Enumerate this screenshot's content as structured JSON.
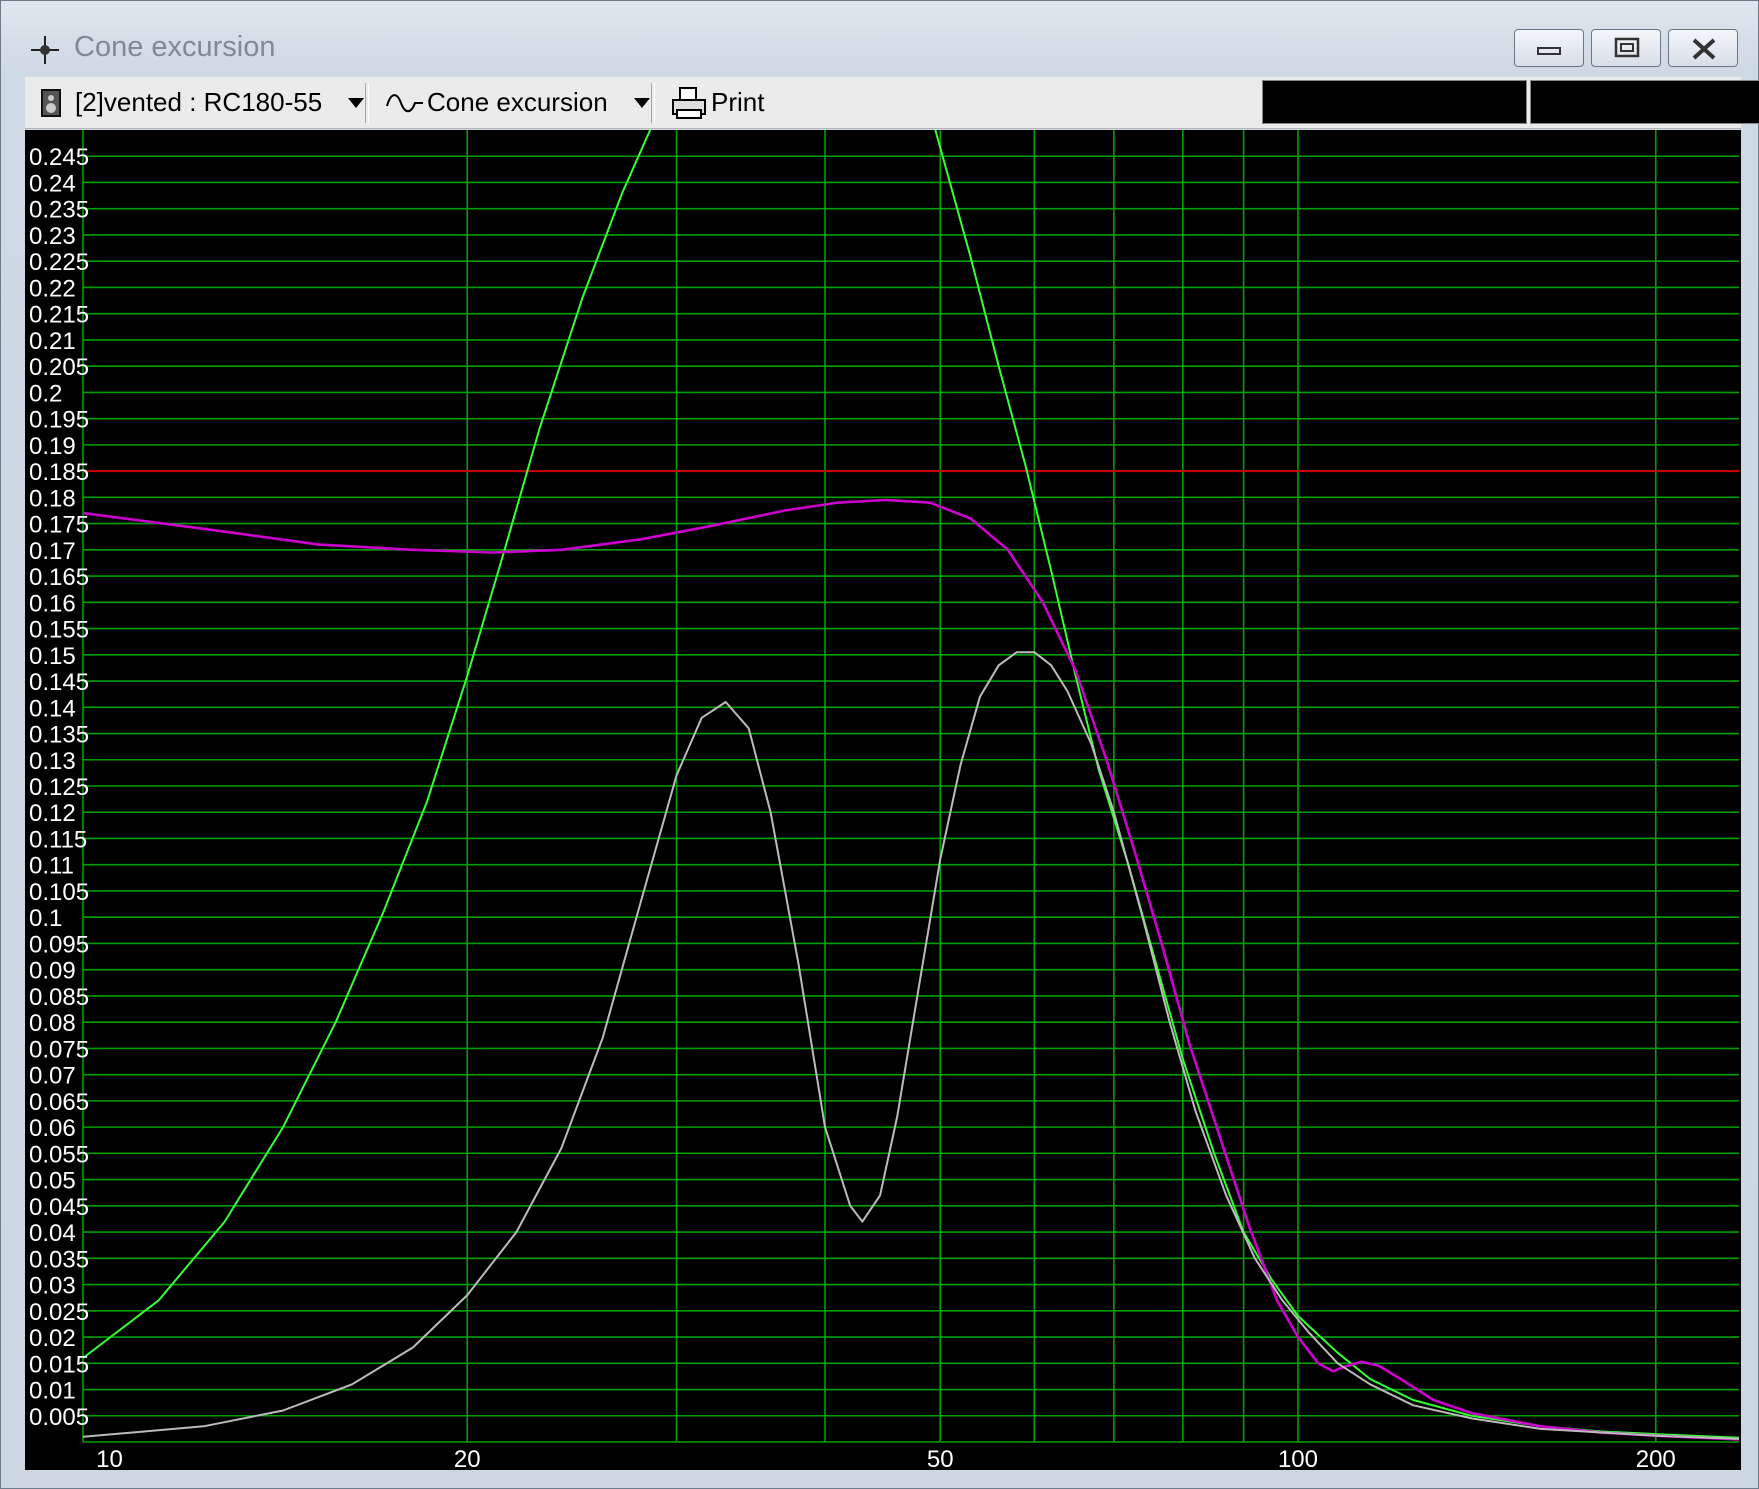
{
  "window": {
    "title": "Cone excursion",
    "icon": "crosshair-icon"
  },
  "toolbar": {
    "speaker_label": "[2]vented : RC180-55",
    "graph_label": "Cone excursion",
    "print_label": "Print"
  },
  "chart_data": {
    "type": "line",
    "x_scale": "log",
    "xlim": [
      9.5,
      235
    ],
    "ylim": [
      0,
      0.25
    ],
    "grid": true,
    "x_ticks": [
      10,
      20,
      50,
      100,
      200
    ],
    "x_gridlines": [
      20,
      30,
      40,
      50,
      60,
      70,
      80,
      90,
      100,
      200
    ],
    "y_ticks": [
      "0.005",
      "0.01",
      "0.015",
      "0.02",
      "0.025",
      "0.03",
      "0.035",
      "0.04",
      "0.045",
      "0.05",
      "0.055",
      "0.06",
      "0.065",
      "0.07",
      "0.075",
      "0.08",
      "0.085",
      "0.09",
      "0.095",
      "0.1",
      "0.105",
      "0.11",
      "0.115",
      "0.12",
      "0.125",
      "0.13",
      "0.135",
      "0.14",
      "0.145",
      "0.15",
      "0.155",
      "0.16",
      "0.165",
      "0.17",
      "0.175",
      "0.18",
      "0.185",
      "0.19",
      "0.195",
      "0.2",
      "0.205",
      "0.21",
      "0.215",
      "0.22",
      "0.225",
      "0.23",
      "0.235",
      "0.24",
      "0.245"
    ],
    "reference_line": {
      "y": 0.185,
      "color": "#cc0000"
    },
    "series": [
      {
        "color": "#33ff33",
        "points": [
          [
            9.5,
            0.016
          ],
          [
            11,
            0.027
          ],
          [
            12.5,
            0.042
          ],
          [
            14,
            0.06
          ],
          [
            15.5,
            0.08
          ],
          [
            17,
            0.101
          ],
          [
            18.5,
            0.122
          ],
          [
            20,
            0.146
          ],
          [
            21.5,
            0.17
          ],
          [
            23,
            0.193
          ],
          [
            25,
            0.218
          ],
          [
            27,
            0.238
          ],
          [
            29,
            0.255
          ],
          [
            45,
            0.262
          ],
          [
            49,
            0.255
          ],
          [
            53,
            0.226
          ],
          [
            56,
            0.205
          ],
          [
            59,
            0.186
          ],
          [
            62,
            0.166
          ],
          [
            65,
            0.146
          ],
          [
            68,
            0.128
          ],
          [
            72,
            0.11
          ],
          [
            76,
            0.091
          ],
          [
            80,
            0.073
          ],
          [
            85,
            0.055
          ],
          [
            90,
            0.04
          ],
          [
            95,
            0.031
          ],
          [
            100,
            0.024
          ],
          [
            108,
            0.017
          ],
          [
            115,
            0.012
          ],
          [
            125,
            0.008
          ],
          [
            140,
            0.005
          ],
          [
            160,
            0.003
          ],
          [
            180,
            0.002
          ],
          [
            200,
            0.0015
          ],
          [
            235,
            0.0008
          ]
        ]
      },
      {
        "color": "#cc00cc",
        "points": [
          [
            9.5,
            0.177
          ],
          [
            12,
            0.174
          ],
          [
            15,
            0.171
          ],
          [
            18,
            0.17
          ],
          [
            21,
            0.1695
          ],
          [
            24,
            0.17
          ],
          [
            28,
            0.172
          ],
          [
            32,
            0.1745
          ],
          [
            37,
            0.1775
          ],
          [
            41,
            0.179
          ],
          [
            45,
            0.1795
          ],
          [
            49,
            0.179
          ],
          [
            53,
            0.176
          ],
          [
            57,
            0.17
          ],
          [
            61,
            0.16
          ],
          [
            65,
            0.147
          ],
          [
            69,
            0.13
          ],
          [
            73,
            0.112
          ],
          [
            77,
            0.094
          ],
          [
            81,
            0.076
          ],
          [
            86,
            0.058
          ],
          [
            91,
            0.041
          ],
          [
            96,
            0.027
          ],
          [
            100,
            0.02
          ],
          [
            104,
            0.015
          ],
          [
            107,
            0.0135
          ],
          [
            110,
            0.0145
          ],
          [
            113,
            0.0153
          ],
          [
            117,
            0.0145
          ],
          [
            122,
            0.012
          ],
          [
            130,
            0.008
          ],
          [
            140,
            0.0055
          ],
          [
            160,
            0.003
          ],
          [
            180,
            0.0018
          ],
          [
            200,
            0.0012
          ],
          [
            235,
            0.0005
          ]
        ]
      },
      {
        "color": "#bbbbbb",
        "points": [
          [
            9.5,
            0.001
          ],
          [
            12,
            0.003
          ],
          [
            14,
            0.006
          ],
          [
            16,
            0.011
          ],
          [
            18,
            0.018
          ],
          [
            20,
            0.028
          ],
          [
            22,
            0.04
          ],
          [
            24,
            0.056
          ],
          [
            26,
            0.077
          ],
          [
            28,
            0.103
          ],
          [
            30,
            0.127
          ],
          [
            31.5,
            0.138
          ],
          [
            33,
            0.141
          ],
          [
            34.5,
            0.136
          ],
          [
            36,
            0.12
          ],
          [
            38,
            0.091
          ],
          [
            40,
            0.06
          ],
          [
            42,
            0.045
          ],
          [
            43,
            0.042
          ],
          [
            44.5,
            0.047
          ],
          [
            46,
            0.062
          ],
          [
            48,
            0.087
          ],
          [
            50,
            0.111
          ],
          [
            52,
            0.129
          ],
          [
            54,
            0.142
          ],
          [
            56,
            0.148
          ],
          [
            58,
            0.1505
          ],
          [
            60,
            0.1505
          ],
          [
            62,
            0.148
          ],
          [
            64,
            0.143
          ],
          [
            67,
            0.133
          ],
          [
            70,
            0.12
          ],
          [
            74,
            0.1
          ],
          [
            78,
            0.08
          ],
          [
            82,
            0.063
          ],
          [
            87,
            0.047
          ],
          [
            92,
            0.035
          ],
          [
            97,
            0.027
          ],
          [
            102,
            0.021
          ],
          [
            108,
            0.015
          ],
          [
            115,
            0.011
          ],
          [
            125,
            0.007
          ],
          [
            140,
            0.0045
          ],
          [
            160,
            0.0025
          ],
          [
            200,
            0.0012
          ],
          [
            235,
            0.0006
          ]
        ]
      }
    ]
  }
}
